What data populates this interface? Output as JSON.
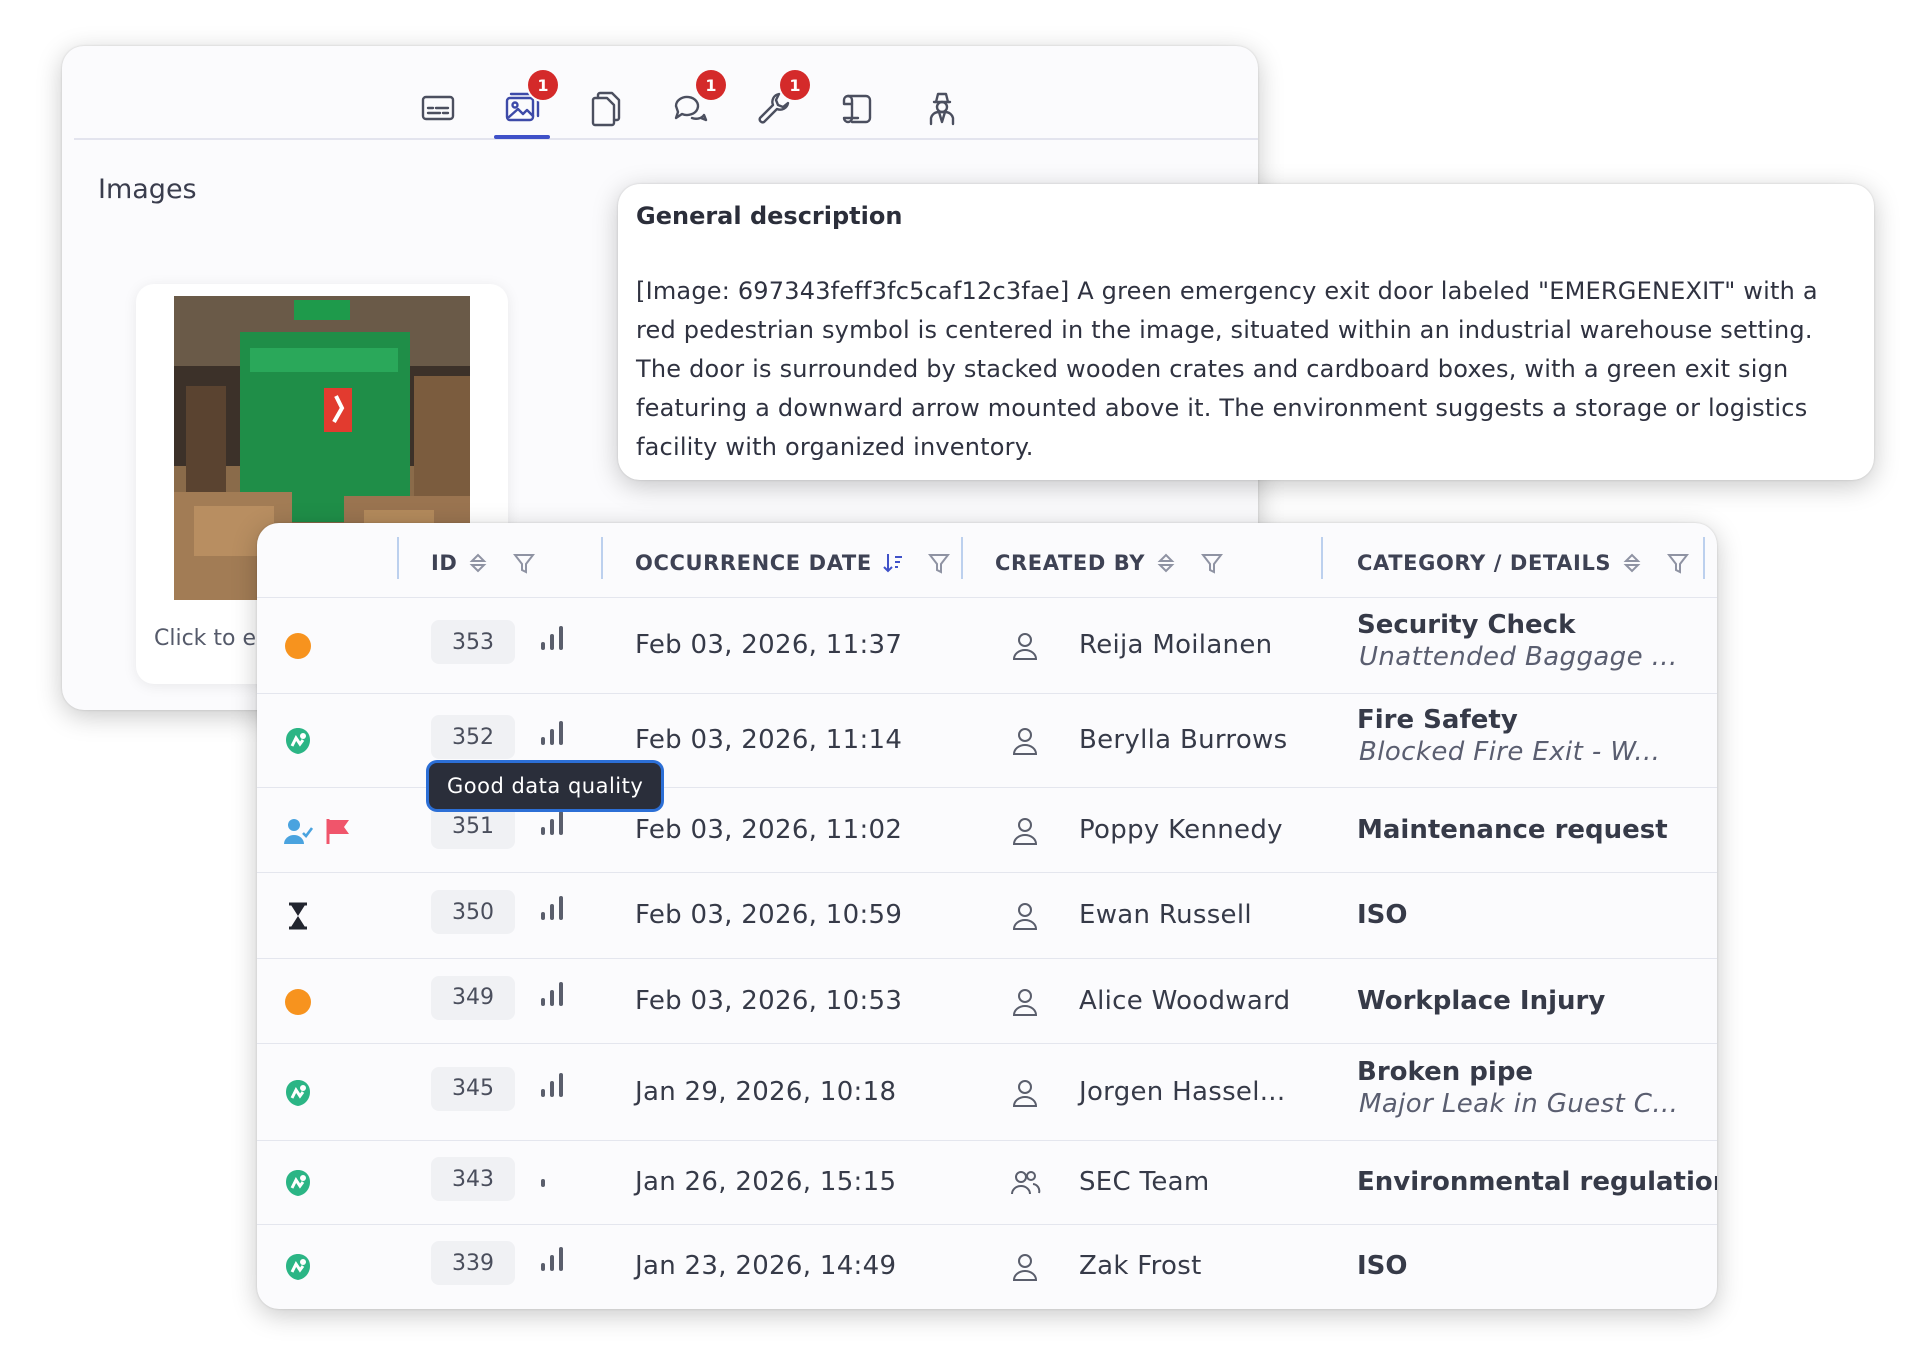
{
  "tabs": [
    {
      "name": "details-icon",
      "badge": ""
    },
    {
      "name": "images-icon",
      "badge": "1",
      "active": true
    },
    {
      "name": "documents-icon",
      "badge": ""
    },
    {
      "name": "comments-icon",
      "badge": "1"
    },
    {
      "name": "actions-icon",
      "badge": "1"
    },
    {
      "name": "route-icon",
      "badge": ""
    },
    {
      "name": "investigator-icon",
      "badge": ""
    }
  ],
  "images_section": {
    "title": "Images",
    "caption": "Click to e"
  },
  "description": {
    "title": "General description",
    "text": "[Image: 697343feff3fc5caf12c3fae] A green emergency exit door labeled \"EMERGENEXIT\" with a red pedestrian symbol is centered in the image, situated within an industrial warehouse setting. The door is surrounded by stacked wooden crates and cardboard boxes, with a green exit sign featuring a downward arrow mounted above it. The environment suggests a storage or logistics facility with organized inventory."
  },
  "table": {
    "headers": {
      "id": "ID",
      "date": "OCCURRENCE DATE",
      "created_by": "CREATED BY",
      "category": "CATEGORY / DETAILS"
    },
    "tooltip": "Good data quality",
    "rows": [
      {
        "status": "orange-dot-icon",
        "id": "353",
        "date": "Feb 03, 2026, 11:37",
        "user_icon": "person-icon",
        "user": "Reija Moilanen",
        "category": "Security Check",
        "detail": "Unattended Baggage ..."
      },
      {
        "status": "green-shield-icon",
        "id": "352",
        "date": "Feb 03, 2026, 11:14",
        "user_icon": "person-icon",
        "user": "Berylla Burrows",
        "category": "Fire Safety",
        "detail": "Blocked Fire Exit - W..."
      },
      {
        "status": "user-check-icon",
        "id": "351",
        "date": "Feb 03, 2026, 11:02",
        "user_icon": "person-icon",
        "user": "Poppy Kennedy",
        "category": "Maintenance request",
        "detail": ""
      },
      {
        "status": "hourglass-icon",
        "id": "350",
        "date": "Feb 03, 2026, 10:59",
        "user_icon": "person-icon",
        "user": "Ewan Russell",
        "category": "ISO",
        "detail": ""
      },
      {
        "status": "orange-dot-icon",
        "id": "349",
        "date": "Feb 03, 2026, 10:53",
        "user_icon": "person-icon",
        "user": "Alice Woodward",
        "category": "Workplace Injury",
        "detail": ""
      },
      {
        "status": "green-shield-icon",
        "id": "345",
        "date": "Jan 29, 2026, 10:18",
        "user_icon": "person-icon",
        "user": "Jorgen Hassel...",
        "category": "Broken pipe",
        "detail": "Major Leak in Guest C..."
      },
      {
        "status": "green-shield-icon",
        "id": "343",
        "date": "Jan 26, 2026, 15:15",
        "user_icon": "team-icon",
        "user": "SEC Team",
        "category": "Environmental regulation",
        "detail": ""
      },
      {
        "status": "green-shield-icon",
        "id": "339",
        "date": "Jan 23, 2026, 14:49",
        "user_icon": "person-icon",
        "user": "Zak Frost",
        "category": "ISO",
        "detail": ""
      }
    ]
  },
  "colors": {
    "accent": "#3f51c8",
    "badge": "#d42a2a",
    "orange": "#f7931e",
    "green": "#2bb585",
    "flag": "#f0556b"
  }
}
